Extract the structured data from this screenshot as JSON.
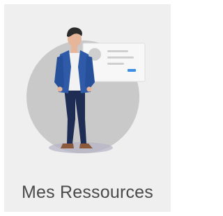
{
  "tile": {
    "label": "Mes Ressources",
    "icon": "person-presenting-card-icon"
  },
  "colors": {
    "tile_background": "#efefef",
    "circle": "#c9c9c9",
    "jacket": "#2e5aa8",
    "trousers": "#1f2d55",
    "card": "#f6f6f6",
    "card_accent": "#3d8ee6",
    "label_text": "#4a4a4a"
  }
}
